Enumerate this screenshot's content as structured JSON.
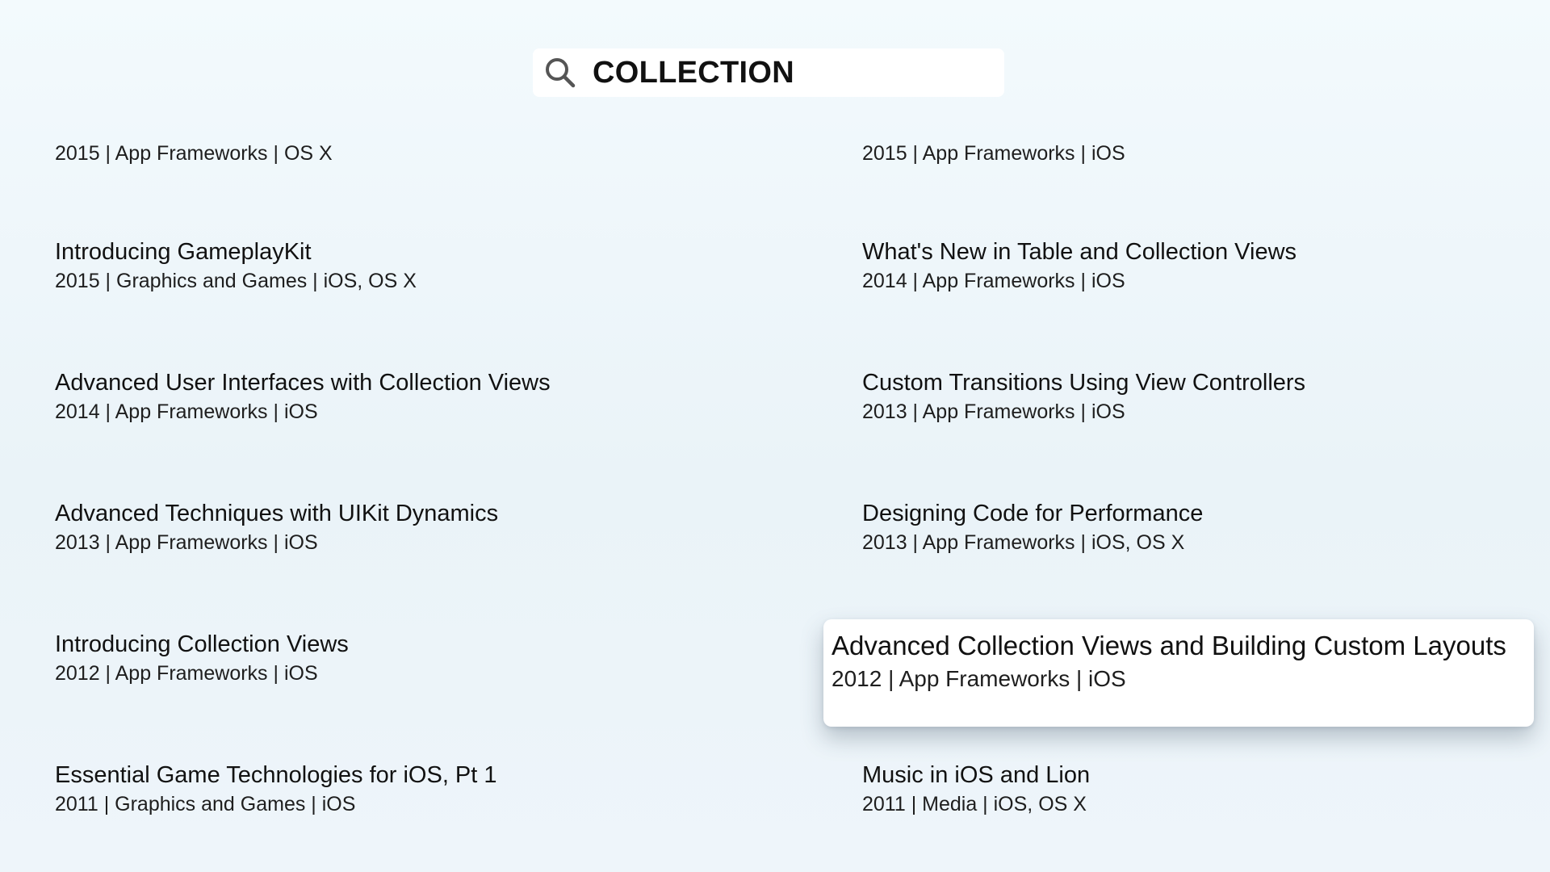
{
  "search": {
    "query": "COLLECTION",
    "icon": "search-icon"
  },
  "results": [
    {
      "title": "",
      "meta": "2015 | App Frameworks | OS X"
    },
    {
      "title": "",
      "meta": "2015 | App Frameworks | iOS"
    },
    {
      "title": "Introducing GameplayKit",
      "meta": "2015 | Graphics and Games | iOS, OS X"
    },
    {
      "title": "What's New in Table and Collection Views",
      "meta": "2014 | App Frameworks | iOS"
    },
    {
      "title": "Advanced User Interfaces with Collection Views",
      "meta": "2014 | App Frameworks | iOS"
    },
    {
      "title": "Custom Transitions Using View Controllers",
      "meta": "2013 | App Frameworks | iOS"
    },
    {
      "title": "Advanced Techniques with UIKit Dynamics",
      "meta": "2013 | App Frameworks | iOS"
    },
    {
      "title": "Designing Code for Performance",
      "meta": "2013 | App Frameworks | iOS, OS X"
    },
    {
      "title": "Introducing Collection Views",
      "meta": "2012 | App Frameworks | iOS"
    },
    {
      "title": "Advanced Collection Views and Building Custom Layouts",
      "meta": "2012 | App Frameworks | iOS"
    },
    {
      "title": "Essential Game Technologies for iOS, Pt 1",
      "meta": "2011 | Graphics and Games | iOS"
    },
    {
      "title": "Music in iOS and Lion",
      "meta": "2011 | Media | iOS, OS X"
    }
  ]
}
